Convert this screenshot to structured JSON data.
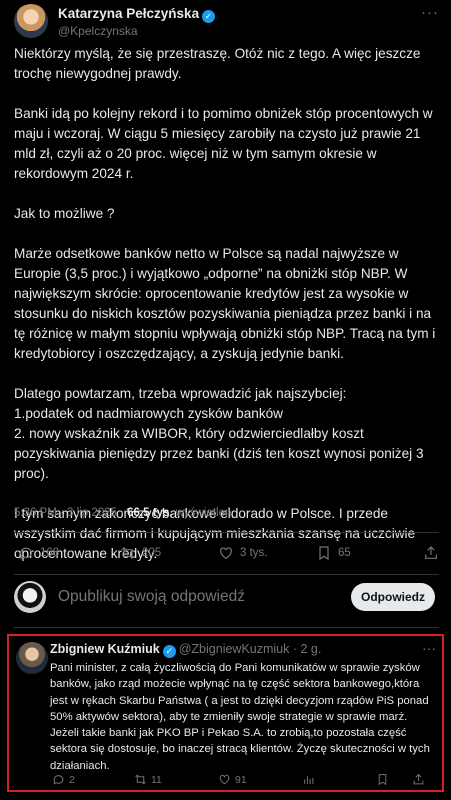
{
  "tweet": {
    "author_name": "Katarzyna Pełczyńska",
    "author_handle": "@Kpelczynska",
    "verified_icon": "✓",
    "more_icon": "···",
    "paragraphs": [
      "Niektórzy myślą, że się przestraszę. Otóż nic z tego. A więc jeszcze trochę niewygodnej prawdy.",
      "Banki idą po kolejny rekord i to pomimo obniżek stóp procentowych w maju i wczoraj. W ciągu 5 miesięcy zarobiły na czysto już prawie 21 mld zł, czyli aż o 20 proc. więcej niż w tym samym okresie w rekordowym 2024 r.",
      "Jak to możliwe ?",
      "Marże odsetkowe banków netto w Polsce są nadal najwyższe w Europie (3,5 proc.) i wyjątkowo „odporne” na obniżki stóp NBP. W największym skrócie: oprocentowanie kredytów jest za wysokie w stosunku do niskich kosztów pozyskiwania pieniądza przez banki i na tę różnicę w małym stopniu wpływają obniżki stóp NBP. Tracą na tym i kredytobiorcy i oszczędzający, a zyskują jedynie banki.",
      "Dlatego powtarzam, trzeba wprowadzić jak najszybciej:",
      "1.podatek od nadmiarowych zysków banków",
      "2. nowy wskaźnik za WIBOR, który odzwierciedlałby koszt pozyskiwania pieniędzy przez banki (dziś ten koszt wynosi poniżej 3 proc).",
      "I tym samym zakończyć bankowe eldorado w Polsce. I przede wszystkim dać firmom i kupującym mieszkania szansę na uczciwie oprocentowane kredyty."
    ],
    "time": "5:36 PM · 3 lip 2025 · ",
    "views_count": "66,5 tys.",
    "views_label": " wyświetleń",
    "replies": "168",
    "reposts": "205",
    "likes": "3 tys.",
    "bookmarks": "65"
  },
  "reply_composer": {
    "placeholder": "Opublikuj swoją odpowiedź",
    "button_label": "Odpowiedz"
  },
  "reply": {
    "author_name": "Zbigniew Kuźmiuk",
    "author_handle": "@ZbigniewKuzmiuk · 2 g.",
    "more_icon": "···",
    "text": "Pani minister, z całą życzliwością do Pani komunikatów w sprawie zysków banków, jako rząd możecie wpłynąć na tę część sektora bankowego,która jest w rękach Skarbu Państwa ( a jest to dzięki decyzjom rządów PiS ponad 50% aktywów sektora), aby te zmieniły swoje strategie w sprawie marż. Jeżeli takie banki jak PKO BP i Pekao S.A. to zrobią,to pozostała  część sektora się dostosuje, bo inaczej stracą klientów. Życzę skuteczności w tych działaniach.",
    "replies": "2",
    "reposts": "11",
    "likes": "91"
  },
  "colors": {
    "background": "#000000",
    "text": "#e7e9ea",
    "muted": "#71767b",
    "accent": "#1d9bf0",
    "highlight_border": "#d32128"
  }
}
